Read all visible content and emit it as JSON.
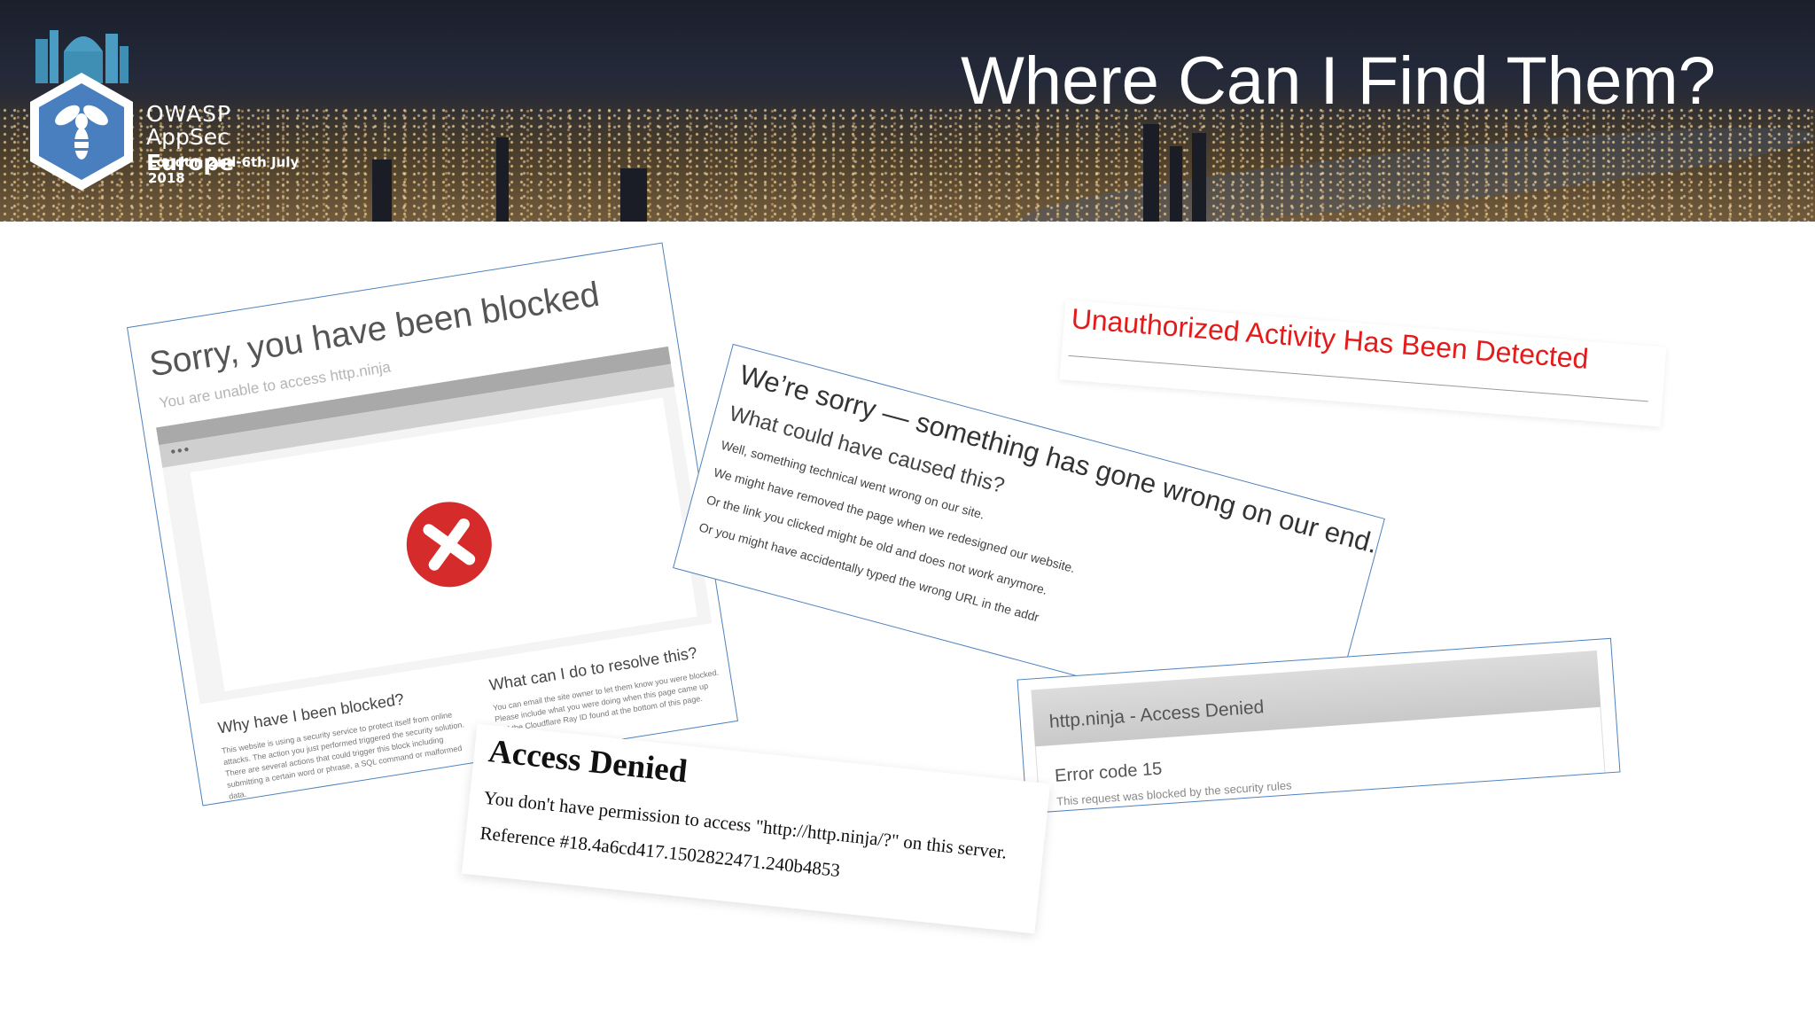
{
  "header": {
    "title": "Where Can I Find Them?",
    "logo": {
      "org": "OWASP",
      "event_regular": "AppSec",
      "event_bold": "Europe",
      "dates": "London 2nd-6th July 2018",
      "icon": "owasp-wasp-icon"
    }
  },
  "cards": {
    "sorry_blocked": {
      "title": "Sorry, you have been blocked",
      "subtitle": "You are unable to access http.ninja",
      "dots": "•••",
      "icon": "red-x-circle-icon",
      "why_heading": "Why have I been blocked?",
      "why_text": "This website is using a security service to protect itself from online attacks. The action you just performed triggered the security solution. There are several actions that could trigger this block including submitting a certain word or phrase, a SQL command or malformed data.",
      "resolve_heading": "What can I do to resolve this?",
      "resolve_text": "You can email the site owner to let them know you were blocked. Please include what you were doing when this page came up and the Cloudflare Ray ID found at the bottom of this page."
    },
    "something_wrong": {
      "heading": "We’re sorry — something has gone wrong on our end.",
      "subheading": "What could have caused this?",
      "lines": [
        "Well, something technical went wrong on our site.",
        "We might have removed the page when we redesigned our website.",
        "Or the link you clicked might be old and does not work anymore.",
        "Or you might have accidentally typed the wrong URL in the addr"
      ]
    },
    "unauthorized": {
      "message": "Unauthorized Activity Has Been Detected",
      "color": "#e31b1b"
    },
    "access_denied": {
      "heading": "Access Denied",
      "message": "You don't have permission to access \"http://http.ninja/?\" on this server.",
      "reference": "Reference #18.4a6cd417.1502822471.240b4853"
    },
    "ninja_denied": {
      "header": "http.ninja - Access Denied",
      "error": "Error code 15",
      "note": "This request was blocked by the security rules"
    }
  },
  "colors": {
    "card_border": "#4f82bd",
    "accent_red": "#d62b2b"
  }
}
